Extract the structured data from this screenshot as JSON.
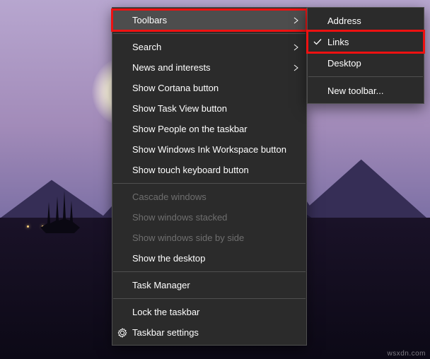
{
  "watermark": "wsxdn.com",
  "main_menu": {
    "toolbars": "Toolbars",
    "search": "Search",
    "news": "News and interests",
    "cortana": "Show Cortana button",
    "taskview": "Show Task View button",
    "people": "Show People on the taskbar",
    "ink": "Show Windows Ink Workspace button",
    "touchkb": "Show touch keyboard button",
    "cascade": "Cascade windows",
    "stacked": "Show windows stacked",
    "sideby": "Show windows side by side",
    "showdesk": "Show the desktop",
    "taskmgr": "Task Manager",
    "lock": "Lock the taskbar",
    "settings": "Taskbar settings"
  },
  "sub_menu": {
    "address": "Address",
    "links": "Links",
    "desktop": "Desktop",
    "newtoolbar": "New toolbar..."
  }
}
